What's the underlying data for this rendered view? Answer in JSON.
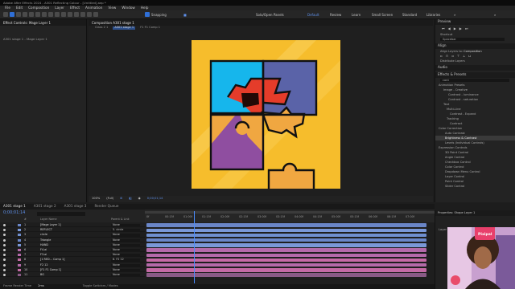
{
  "app": {
    "title": "Adobe After Effects 2024 - A301 Reflecting Colour - [Untitled].aep *"
  },
  "menu": [
    "File",
    "Edit",
    "Composition",
    "Layer",
    "Effect",
    "Animation",
    "View",
    "Window",
    "Help"
  ],
  "workspaces": [
    "Default",
    "Review",
    "Learn",
    "Small Screen",
    "Standard",
    "Libraries"
  ],
  "toolbar": {
    "snap_label": "Snapping",
    "solo_label": "Solo/Open Panels"
  },
  "left_panel": {
    "tabs": [
      "Effect Controls: Mage Layer 1"
    ],
    "breadcrumb": "A301 stage 1 - Mage Layer 1"
  },
  "comp_panel": {
    "tabs": [
      "Composition A301 stage 1"
    ],
    "sub_tabs": [
      "Class 2 1",
      "A301 stage 1",
      "F1 F1 Comp 1"
    ],
    "zoom": "100%",
    "quality": "(Full)",
    "timecode": "0;00;01;14"
  },
  "right_panel": {
    "sections": [
      "Preview",
      "Shortcut",
      "Align",
      "Align Layers to:",
      "Distribute Layers",
      "Audio",
      "Effects & Presets"
    ],
    "shortcut_value": "Spacebar",
    "align_target": "Composition",
    "search_value": "cont",
    "effects_tree": [
      "Animation Presets",
      "Image - Creative",
      "Contrast - luminance",
      "Contrast - saturation",
      "Text",
      "Multi-Line",
      "Contrast - Expand",
      "Tracking",
      "Contract",
      "Color Correction",
      "Auto Contrast",
      "Brightness & Contrast",
      "Levels (Individual Controls)",
      "Expression Controls",
      "3D Point Control",
      "Angle Control",
      "Checkbox Control",
      "Color Control",
      "Dropdown Menu Control",
      "Layer Control",
      "Point Control",
      "Slider Control"
    ]
  },
  "timeline": {
    "tabs": [
      "A301 stage 1",
      "A301 stage 2",
      "A301 stage 3",
      "Render Queue"
    ],
    "timecode": "0;00;01;14",
    "column_headers": [
      "#",
      "Layer Name",
      "Parent & Link"
    ],
    "ruler_ticks": [
      "0f",
      "00:15f",
      "01:00f",
      "01:15f",
      "02:00f",
      "02:15f",
      "03:00f",
      "03:15f",
      "04:00f",
      "04:15f",
      "05:00f",
      "05:15f",
      "06:00f",
      "06:15f",
      "07:00f"
    ],
    "layers": [
      {
        "num": "1",
        "name": "[Mage Layer 1]",
        "parent": "None",
        "color": "#6a86c8"
      },
      {
        "num": "2",
        "name": "REFLECT",
        "parent": "5. circle",
        "color": "#7a98d8"
      },
      {
        "num": "3",
        "name": "circle",
        "parent": "None",
        "color": "#6f8fcf"
      },
      {
        "num": "4",
        "name": "Triangle",
        "parent": "None",
        "color": "#6a86c8"
      },
      {
        "num": "5",
        "name": "HAND",
        "parent": "None",
        "color": "#7a98d8"
      },
      {
        "num": "6",
        "name": "F4.ai",
        "parent": "None",
        "color": "#b46aa9"
      },
      {
        "num": "7",
        "name": "F3.ai",
        "parent": "None",
        "color": "#b46aa9"
      },
      {
        "num": "8",
        "name": "[1 RED... Comp 1]",
        "parent": "8. F2 12",
        "color": "#c46aa5"
      },
      {
        "num": "9",
        "name": "F2 12",
        "parent": "None",
        "color": "#b46aa9"
      },
      {
        "num": "10",
        "name": "[F1 F1 Comp 1]",
        "parent": "None",
        "color": "#c46aa5"
      },
      {
        "num": "11",
        "name": "BG",
        "parent": "None",
        "color": "#8a5a86"
      }
    ]
  },
  "status": {
    "render_time_label": "Frame Render Time",
    "render_time": "2ms",
    "toggle_label": "Toggle Switches / Modes"
  },
  "properties": {
    "title": "Properties: Shape Layer 1",
    "section": "Layer Transform"
  },
  "webcam": {
    "badge": "Pixipal"
  }
}
